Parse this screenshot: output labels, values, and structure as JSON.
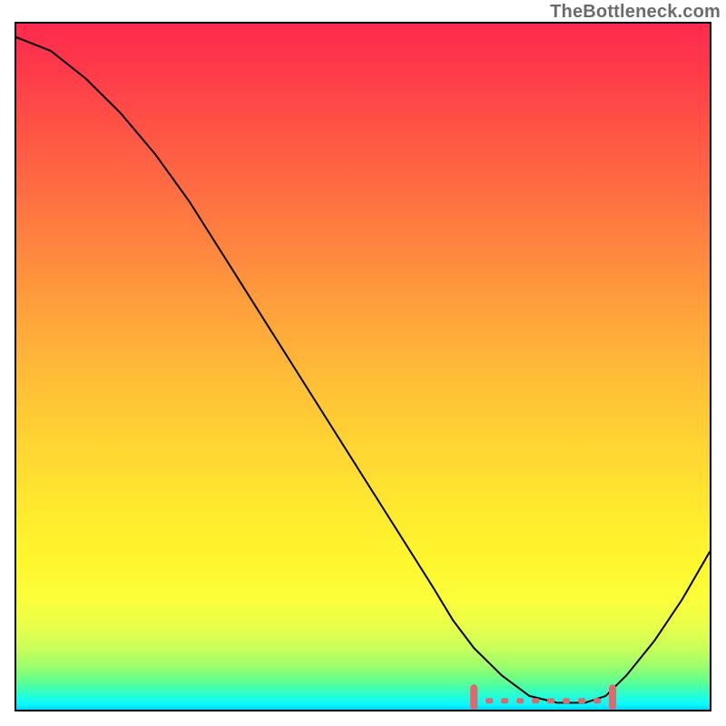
{
  "watermark": "TheBottleneck.com",
  "chart_data": {
    "type": "line",
    "title": "",
    "xlabel": "",
    "ylabel": "",
    "xlim": [
      0,
      100
    ],
    "ylim": [
      0,
      100
    ],
    "grid": false,
    "legend": false,
    "series": [
      {
        "name": "bottleneck-curve",
        "x": [
          0,
          5,
          10,
          15,
          20,
          25,
          30,
          35,
          40,
          45,
          50,
          55,
          60,
          63,
          66,
          70,
          74,
          78,
          82,
          85,
          88,
          92,
          96,
          100
        ],
        "values": [
          98,
          96,
          92,
          87,
          81,
          74,
          66,
          58,
          50,
          42,
          34,
          26,
          18,
          13,
          9,
          5,
          2,
          1,
          1,
          2,
          5,
          10,
          16,
          23
        ]
      }
    ],
    "highlight_range": {
      "name": "optimal-window-dots",
      "x_start": 66,
      "x_end": 86,
      "y_level": 1.3,
      "color": "#e0686c"
    }
  }
}
